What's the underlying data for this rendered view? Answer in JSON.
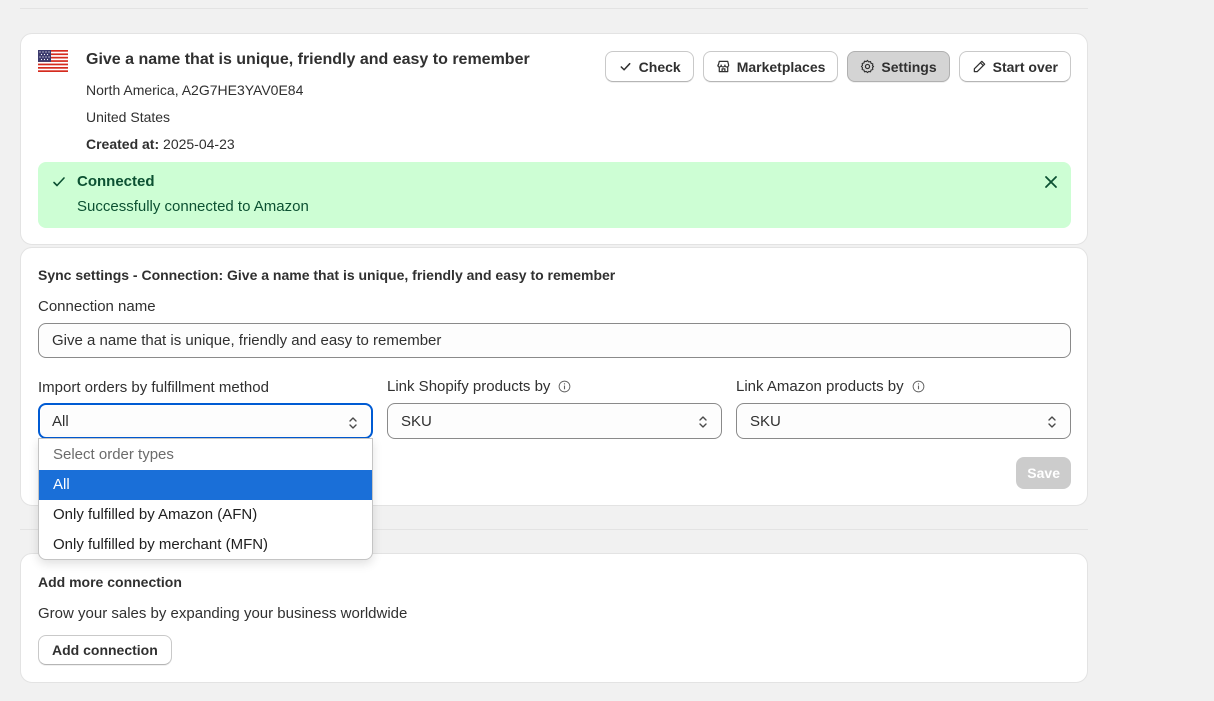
{
  "connection": {
    "title": "Give a name that is unique, friendly and easy to remember",
    "region": "North America, A2G7HE3YAV0E84",
    "country": "United States",
    "created_label": "Created at:",
    "created_value": "2025-04-23",
    "flag_icon": "us-flag-icon",
    "buttons": {
      "check": "Check",
      "marketplaces": "Marketplaces",
      "settings": "Settings",
      "start_over": "Start over"
    },
    "banner": {
      "title": "Connected",
      "text": "Successfully connected to Amazon",
      "color": "#cdfed4"
    }
  },
  "sync": {
    "title": "Sync settings - Connection: Give a name that is unique, friendly and easy to remember",
    "name_label": "Connection name",
    "name_value": "Give a name that is unique, friendly and easy to remember",
    "import_label": "Import orders by fulfillment method",
    "import_value": "All",
    "shopify_label": "Link Shopify products by",
    "shopify_value": "SKU",
    "amazon_label": "Link Amazon products by",
    "amazon_value": "SKU",
    "save_label": "Save",
    "dropdown": {
      "placeholder": "Select order types",
      "options": [
        "All",
        "Only fulfilled by Amazon (AFN)",
        "Only fulfilled by merchant (MFN)"
      ],
      "selected": "All"
    }
  },
  "add": {
    "title": "Add more connection",
    "text": "Grow your sales by expanding your business worldwide",
    "button": "Add connection"
  },
  "colors": {
    "accent": "#005bd3",
    "selected_option": "#1a6fd8",
    "success_text": "#0c5132"
  }
}
